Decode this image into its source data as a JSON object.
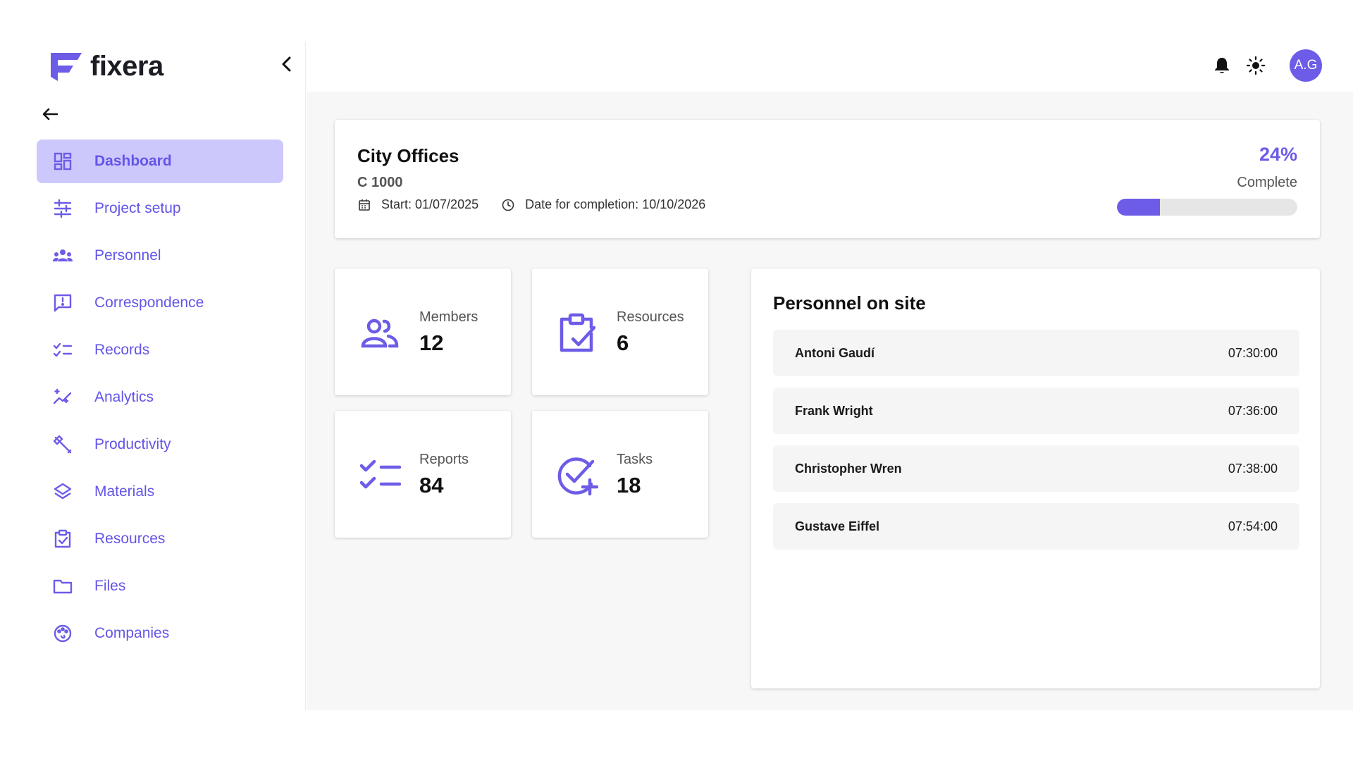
{
  "brand": {
    "name": "fixera",
    "accent": "#6c5ce7",
    "active_bg": "#cdc8fb"
  },
  "sidebar": {
    "items": [
      {
        "label": "Dashboard",
        "icon": "dashboard-icon",
        "active": true
      },
      {
        "label": "Project setup",
        "icon": "sliders-icon"
      },
      {
        "label": "Personnel",
        "icon": "group-icon"
      },
      {
        "label": "Correspondence",
        "icon": "chat-icon"
      },
      {
        "label": "Records",
        "icon": "checklist-icon"
      },
      {
        "label": "Analytics",
        "icon": "analytics-icon"
      },
      {
        "label": "Productivity",
        "icon": "tools-icon"
      },
      {
        "label": "Materials",
        "icon": "layers-icon"
      },
      {
        "label": "Resources",
        "icon": "clipboard-check-icon"
      },
      {
        "label": "Files",
        "icon": "folder-icon"
      },
      {
        "label": "Companies",
        "icon": "palette-icon"
      }
    ]
  },
  "header": {
    "avatar_initials": "A.G"
  },
  "project": {
    "name": "City Offices",
    "code": "C 1000",
    "start": "Start: 01/07/2025",
    "completion": "Date for completion: 10/10/2026",
    "progress_percent": 24,
    "progress_label": "24%",
    "complete_label": "Complete"
  },
  "stats": [
    {
      "label": "Members",
      "value": "12",
      "icon": "people-icon"
    },
    {
      "label": "Resources",
      "value": "6",
      "icon": "clipboard-check-icon"
    },
    {
      "label": "Reports",
      "value": "84",
      "icon": "checklist-icon"
    },
    {
      "label": "Tasks",
      "value": "18",
      "icon": "check-circle-add-icon"
    }
  ],
  "personnel": {
    "title": "Personnel on site",
    "rows": [
      {
        "name": "Antoni Gaudí",
        "time": "07:30:00"
      },
      {
        "name": "Frank Wright",
        "time": "07:36:00"
      },
      {
        "name": "Christopher Wren",
        "time": "07:38:00"
      },
      {
        "name": "Gustave Eiffel",
        "time": "07:54:00"
      }
    ]
  }
}
